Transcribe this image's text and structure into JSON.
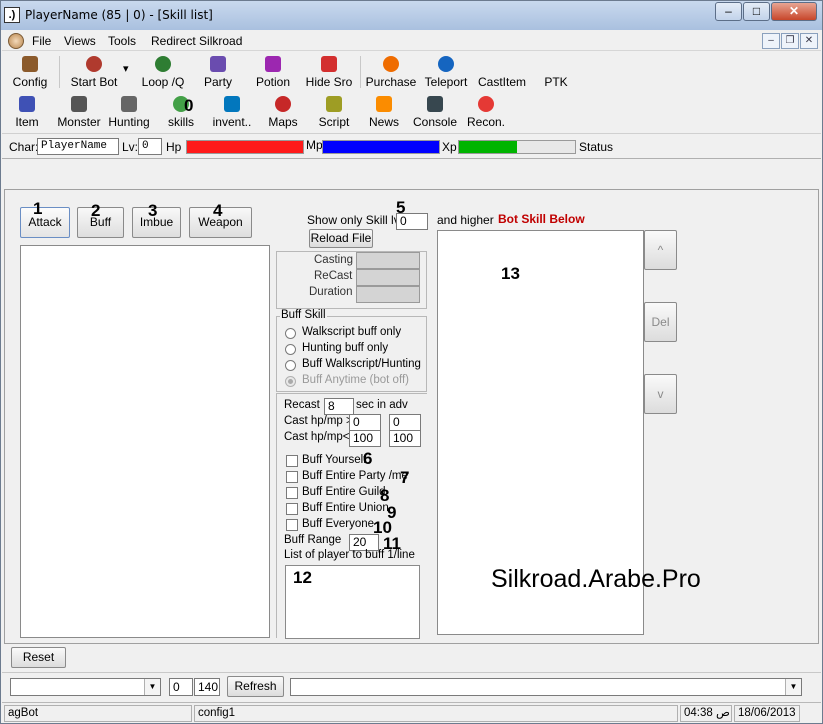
{
  "window": {
    "title": "PlayerName (85 | 0)  - [Skill list]",
    "icon_text": ".)",
    "minimize": "–",
    "maximize": "□",
    "close": "✕"
  },
  "menu": {
    "items": [
      "File",
      "Views",
      "Tools",
      "Redirect Silkroad"
    ],
    "mdi_min": "–",
    "mdi_restore": "❐",
    "mdi_close": "✕"
  },
  "toolbar1": [
    {
      "label": "Config",
      "icon": "config-icon",
      "color": "#8b5a2b"
    },
    {
      "label": "Start Bot",
      "icon": "start-bot-icon",
      "color": "#b03a2e",
      "dropdown": "▾"
    },
    {
      "label": "Loop /Q",
      "icon": "loop-icon",
      "color": "#2e7d32"
    },
    {
      "label": "Party",
      "icon": "party-icon",
      "color": "#6a4caf"
    },
    {
      "label": "Potion",
      "icon": "potion-icon",
      "color": "#9c27b0"
    },
    {
      "label": "Hide Sro",
      "icon": "hide-sro-icon",
      "color": "#d32f2f"
    },
    {
      "label": "Purchase",
      "icon": "purchase-icon",
      "color": "#ef6c00"
    },
    {
      "label": "Teleport",
      "icon": "teleport-icon",
      "color": "#1565c0"
    },
    {
      "label": "CastItem",
      "icon": "",
      "color": ""
    },
    {
      "label": "PTK",
      "icon": "",
      "color": ""
    }
  ],
  "toolbar2": [
    {
      "label": "Item",
      "icon": "item-icon",
      "color": "#3f51b5"
    },
    {
      "label": "Monster",
      "icon": "monster-icon",
      "color": "#555555"
    },
    {
      "label": "Hunting",
      "icon": "hunting-icon",
      "color": "#666666"
    },
    {
      "label": "skills",
      "icon": "skills-icon",
      "color": "#43a047"
    },
    {
      "label": "invent..",
      "icon": "inventory-icon",
      "color": "#0277bd"
    },
    {
      "label": "Maps",
      "icon": "maps-icon",
      "color": "#c62828"
    },
    {
      "label": "Script",
      "icon": "script-icon",
      "color": "#9e9d24"
    },
    {
      "label": "News",
      "icon": "news-icon",
      "color": "#fb8c00"
    },
    {
      "label": "Console",
      "icon": "console-icon",
      "color": "#37474f"
    },
    {
      "label": "Recon.",
      "icon": "recon-icon",
      "color": "#e53935"
    }
  ],
  "skills_marker": "0",
  "status": {
    "char_label": "Char:",
    "char_value": "PlayerName",
    "lv_label": "Lv:",
    "lv_value": "0",
    "hp_label": "Hp",
    "mp_label": "Mp",
    "xp_label": "Xp",
    "status_label": "Status",
    "hp_color": "#ff1a1a",
    "mp_color": "#0000ff",
    "xp_color": "#00b400",
    "hp_fill": 100,
    "mp_fill": 100,
    "xp_fill": 50
  },
  "tabs": [
    {
      "label": "Attack",
      "num": "1"
    },
    {
      "label": "Buff",
      "num": "2"
    },
    {
      "label": "Imbue",
      "num": "3"
    },
    {
      "label": "Weapon",
      "num": "4"
    }
  ],
  "filter": {
    "show_only_label": "Show only Skill lv",
    "skill_lv_value": "0",
    "num": "5",
    "and_higher": "and higher",
    "bot_skill_below": "Bot Skill Below",
    "bot_skill_color": "#c00000",
    "reload_file": "Reload File"
  },
  "timings": {
    "casting": "Casting",
    "recast": "ReCast",
    "duration": "Duration"
  },
  "buff_skill": {
    "group_label": "Buff Skill",
    "options": [
      "Walkscript buff only",
      "Hunting buff only",
      "Buff Walkscript/Hunting",
      "Buff Anytime (bot off)"
    ]
  },
  "recast": {
    "label": "Recast",
    "value": "8",
    "suffix": "sec in adv",
    "cast_hpmp_gt": "Cast hp/mp >",
    "gt_hp": "0",
    "gt_mp": "0",
    "cast_hpmp_lt": "Cast hp/mp<",
    "lt_hp": "100",
    "lt_mp": "100"
  },
  "checks": [
    {
      "label": "Buff Yourself",
      "num": "6"
    },
    {
      "label": "Buff Entire Party /me",
      "num": "7"
    },
    {
      "label": "Buff Entire Guild",
      "num": "8"
    },
    {
      "label": "Buff Entire Union",
      "num": "9"
    },
    {
      "label": "Buff Everyone",
      "num": "10"
    }
  ],
  "buff_range": {
    "label": "Buff Range",
    "value": "20",
    "num": "11"
  },
  "player_list": {
    "label": "List of player to buff 1/line",
    "num": "12"
  },
  "right_list": {
    "num": "13"
  },
  "side_buttons": {
    "up": "^",
    "del": "Del",
    "down": "v"
  },
  "watermark": "Silkroad.Arabe.Pro",
  "reset": "Reset",
  "bottom": {
    "num_a": "0",
    "num_b": "140",
    "refresh": "Refresh",
    "arrow": "▼"
  },
  "statusbar": {
    "app": "agBot",
    "config": "config1",
    "time": "04:38 ص",
    "date": "18/06/2013"
  }
}
